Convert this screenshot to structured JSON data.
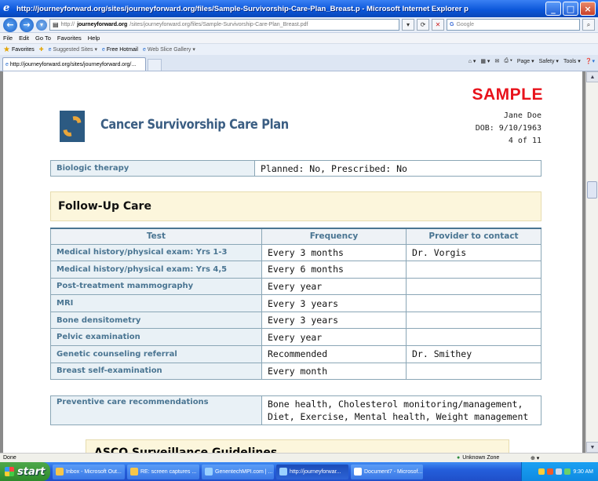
{
  "window": {
    "title": "http://journeyforward.org/sites/journeyforward.org/files/Sample-Survivorship-Care-Plan_Breast.p - Microsoft Internet Explorer p"
  },
  "address": {
    "prefix": "http://",
    "domain": "journeyforward.org",
    "path": "/sites/journeyforward.org/files/Sample-Survivorship-Care-Plan_Breast.pdf",
    "search_placeholder": "Google"
  },
  "menu": [
    "File",
    "Edit",
    "Go To",
    "Favorites",
    "Help"
  ],
  "favorites": {
    "label": "Favorites",
    "items": [
      "Suggested Sites ▾",
      "Free Hotmail",
      "Web Slice Gallery ▾"
    ]
  },
  "tab": {
    "label": "http://journeyforward.org/sites/journeyforward.org/..."
  },
  "commands": [
    "Page ▾",
    "Safety ▾",
    "Tools ▾"
  ],
  "document": {
    "sample_stamp": "SAMPLE",
    "title": "Cancer Survivorship Care Plan",
    "patient_name": "Jane Doe",
    "dob": "DOB: 9/10/1963",
    "page": "4 of 11",
    "biologic": {
      "label": "Biologic therapy",
      "value": "Planned:  No, Prescribed:  No"
    },
    "followup_heading": "Follow-Up Care",
    "followup_table": {
      "headers": [
        "Test",
        "Frequency",
        "Provider to contact"
      ],
      "rows": [
        [
          "Medical history/physical exam: Yrs 1-3",
          "Every 3 months",
          "Dr. Vorgis"
        ],
        [
          "Medical history/physical exam: Yrs 4,5",
          "Every 6 months",
          ""
        ],
        [
          "Post-treatment mammography",
          "Every year",
          ""
        ],
        [
          "MRI",
          "Every 3 years",
          ""
        ],
        [
          "Bone densitometry",
          "Every 3 years",
          ""
        ],
        [
          "Pelvic examination",
          "Every year",
          ""
        ],
        [
          "Genetic counseling referral",
          "Recommended",
          "Dr. Smithey"
        ],
        [
          "Breast self-examination",
          "Every month",
          ""
        ]
      ]
    },
    "preventive": {
      "label": "Preventive care recommendations",
      "line1": "Bone health, Cholesterol monitoring/management,",
      "line2": "Diet, Exercise, Mental health, Weight management"
    },
    "next_section": "ASCO Surveillance Guidelines"
  },
  "status": {
    "text": "Done",
    "zone": "Unknown Zone",
    "zoom": "⊕ ▾"
  },
  "taskbar": {
    "start": "start",
    "tasks": [
      "Inbox - Microsoft Out...",
      "RE: screen captures ...",
      "GenentechMPI.com | ...",
      "http://journeyforwar...",
      "Document7 - Microsof..."
    ],
    "clock": "9:30 AM"
  }
}
